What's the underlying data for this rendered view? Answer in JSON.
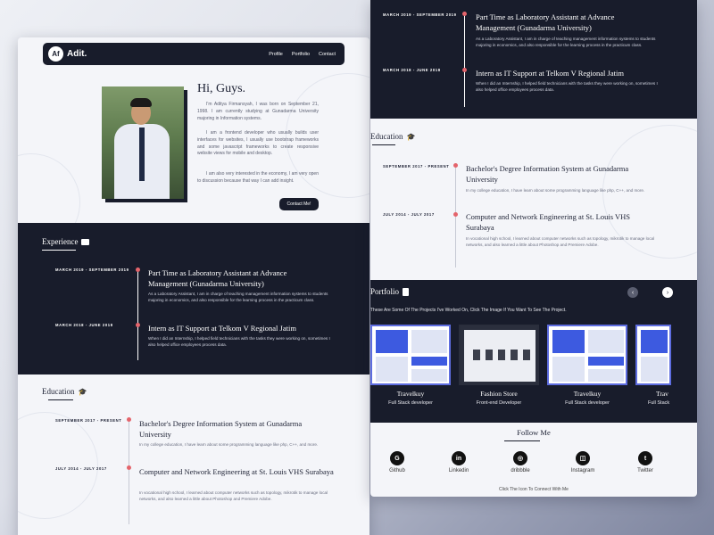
{
  "nav": {
    "logo_badge": "Af",
    "logo_text": "Adit.",
    "links": [
      "Profile",
      "Portfolio",
      "Contact"
    ]
  },
  "hero": {
    "title": "Hi, Guys.",
    "paragraphs": [
      "I'm Aditya Firmansyah, I was born on September 21, 1998. I am currently studying at Gunadarma University majoring in Information systems.",
      "I am a frontend developer who usually builds user interfaces for websites, I usually use bootstrap frameworks and some javascript frameworks to create responsive website views for mobile and desktop.",
      "I am also very interested in the economy, I am very open to discussion because that way I can add insight."
    ],
    "button": "Contact Me!"
  },
  "experience": {
    "title": "Experience",
    "items": [
      {
        "date": "MARCH 2019 - SEPTEMBER 2019",
        "title": "Part Time as Laboratory Assistant at Advance Management (Gunadarma University)",
        "desc": "As a Laboratory Assistant, I am in charge of teaching management information systems to students majoring in economics, and also responsible for the learning process in the practicum class."
      },
      {
        "date": "MARCH 2018 - JUNE 2018",
        "title": "Intern as IT Support at Telkom V Regional Jatim",
        "desc": "When I did an Internship, I helped field technicians with the tasks they were working on, sometimes I also helped office employees process data."
      }
    ]
  },
  "education": {
    "title": "Education",
    "items": [
      {
        "date": "SEPTEMBER 2017 - PRESENT",
        "title": "Bachelor's Degree Information System at Gunadarma University",
        "desc": "In my college education, I have learn about some programming language like php, C++, and more."
      },
      {
        "date": "JULY 2014 - JULY 2017",
        "title": "Computer and Network Engineering at St. Louis VHS Surabaya",
        "desc": "In vocational high school, I learned about computer networks such as topology, mikrotik to manage local networks, and also learned a little about Photoshop and Premiere Adobe."
      }
    ]
  },
  "portfolio": {
    "title": "Portfolio",
    "subtitle": "These Are Some Of The Projects I've Worked On, Click The Image If You Want To See The Project.",
    "projects": [
      {
        "name": "Travelkuy",
        "role": "Full Stack developer"
      },
      {
        "name": "Fashion Store",
        "role": "Front-end Developer"
      },
      {
        "name": "Travelkuy",
        "role": "Full Stack developer"
      },
      {
        "name": "Trav",
        "role": "Full Stack"
      }
    ],
    "prev_glyph": "‹",
    "next_glyph": "›"
  },
  "follow": {
    "title": "Follow Me",
    "socials": [
      {
        "label": "Github",
        "glyph": "G",
        "icon": "github-icon"
      },
      {
        "label": "Linkedin",
        "glyph": "in",
        "icon": "linkedin-icon"
      },
      {
        "label": "dribbble",
        "glyph": "◎",
        "icon": "dribbble-icon"
      },
      {
        "label": "Instagram",
        "glyph": "◫",
        "icon": "instagram-icon"
      },
      {
        "label": "Twitter",
        "glyph": "t",
        "icon": "twitter-icon"
      }
    ],
    "footnote": "Click The Icon To Connect With Me"
  },
  "colors": {
    "dark": "#181c2b",
    "accent_dot": "#e4646b",
    "light_bg": "#f4f5f9",
    "portfolio_border": "#5e6de0"
  }
}
